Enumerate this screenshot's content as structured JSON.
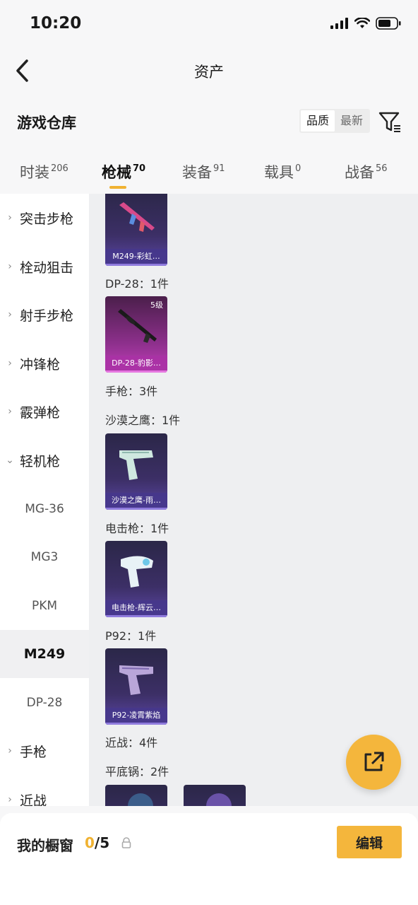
{
  "status": {
    "time": "10:20"
  },
  "nav": {
    "title": "资产"
  },
  "warehouse": {
    "title": "游戏仓库",
    "sort_quality": "品质",
    "sort_latest": "最新"
  },
  "tabs": [
    {
      "label": "时装",
      "count": "206"
    },
    {
      "label": "枪械",
      "count": "70"
    },
    {
      "label": "装备",
      "count": "91"
    },
    {
      "label": "载具",
      "count": "0"
    },
    {
      "label": "战备",
      "count": "56"
    }
  ],
  "sidebar": {
    "categories": [
      "突击步枪",
      "栓动狙击",
      "射手步枪",
      "冲锋枪",
      "霰弹枪",
      "轻机枪",
      "手枪",
      "近战"
    ],
    "subs": [
      "MG-36",
      "MG3",
      "PKM",
      "M249",
      "DP-28"
    ]
  },
  "content": {
    "groups": [
      "DP-28：1件",
      "手枪：3件",
      "沙漠之鹰：1件",
      "电击枪：1件",
      "P92：1件",
      "近战：4件",
      "平底锅：2件"
    ],
    "cards": [
      {
        "caption": "M249-彩虹…",
        "level": ""
      },
      {
        "caption": "DP-28-豹影…",
        "level": "5级"
      },
      {
        "caption": "沙漠之鹰-雨…",
        "level": ""
      },
      {
        "caption": "电击枪-辉云…",
        "level": ""
      },
      {
        "caption": "P92-凌霄紫焰",
        "level": ""
      }
    ]
  },
  "bottom": {
    "label": "我的橱窗",
    "count_current": "0",
    "count_total": "/5",
    "edit": "编辑"
  },
  "colors": {
    "accent": "#f4b63c",
    "card_purple": "#5b46a5",
    "card_pink": "#c13fb9"
  }
}
